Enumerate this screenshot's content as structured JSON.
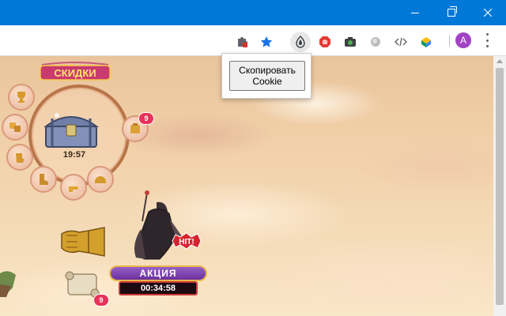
{
  "window": {
    "minimize_icon": "minimize-icon",
    "maximize_icon": "restore-icon",
    "close_icon": "close-icon"
  },
  "toolbar": {
    "extensions": [
      {
        "name": "puzzle-extension-icon",
        "color": "#5f6368"
      },
      {
        "name": "star-bookmark-icon",
        "color": "#1a73e8"
      },
      {
        "name": "cookie-extension-icon",
        "color": "#3c4043"
      },
      {
        "name": "adblock-hand-icon",
        "color": "#e53935"
      },
      {
        "name": "camera-extension-icon",
        "color": "#2e7d32"
      },
      {
        "name": "grey-circle-extension-icon",
        "color": "#9e9e9e"
      },
      {
        "name": "code-extension-icon",
        "color": "#5f6368"
      },
      {
        "name": "colorful-extension-icon",
        "color": "#0f9d58"
      }
    ],
    "avatar_letter": "A",
    "avatar_color": "#a142c4"
  },
  "popup": {
    "button_line1": "Скопировать",
    "button_line2": "Cookie"
  },
  "game": {
    "sale_title": "СКИДКИ",
    "chest_timer": "19:57",
    "ring_badge_count": "9",
    "hit_label": "HIT!",
    "promo_label": "АКЦИЯ",
    "promo_timer": "00:34:58",
    "scroll_badge_count": "9"
  }
}
